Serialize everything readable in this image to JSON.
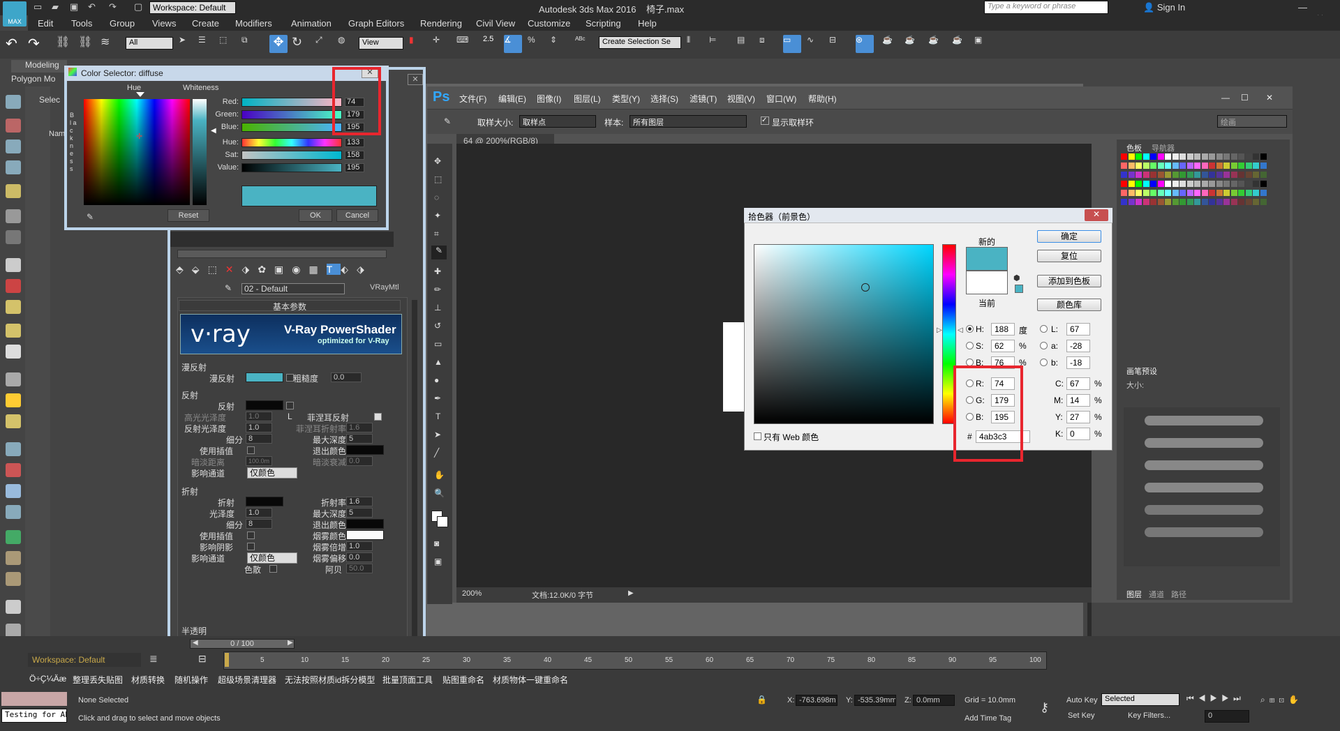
{
  "app": {
    "title": "Autodesk 3ds Max 2016",
    "file": "椅子.max",
    "logo": "MAX",
    "workspace": "Workspace: Default",
    "search_placeholder": "Type a keyword or phrase",
    "sign_in": "Sign In",
    "workspace_bottom": "Workspace: Default"
  },
  "menu": [
    "Edit",
    "Tools",
    "Group",
    "Views",
    "Create",
    "Modifiers",
    "Animation",
    "Graph Editors",
    "Rendering",
    "Civil View",
    "Customize",
    "Scripting",
    "Help"
  ],
  "toolbar": {
    "filter": "All",
    "view": "View",
    "snap": "2.5",
    "selset": "Create Selection Se"
  },
  "ribbon": {
    "tab1": "Modeling",
    "tab2": "Polygon Mo",
    "select": "Selec",
    "name": "Nam"
  },
  "colorsel": {
    "title": "Color Selector: diffuse",
    "hue": "Hue",
    "whiteness": "Whiteness",
    "blackness": "B l a c k n e s s",
    "red_label": "Red:",
    "green_label": "Green:",
    "blue_label": "Blue:",
    "hue_label": "Hue:",
    "sat_label": "Sat:",
    "value_label": "Value:",
    "red": "74",
    "green": "179",
    "blue": "195",
    "hue_val": "133",
    "sat_val": "158",
    "val_val": "195",
    "reset": "Reset",
    "ok": "OK",
    "cancel": "Cancel",
    "swatch": "#4ab3c3"
  },
  "mated": {
    "material": "02 - Default",
    "type": "VRayMtl",
    "basic": "基本参数",
    "vray_main": "V-Ray PowerShader",
    "vray_sub": "optimized for V-Ray",
    "vray_logo": "v·ray",
    "diffuse_group": "漫反射",
    "diffuse": "漫反射",
    "roughness": "粗糙度",
    "roughness_val": "0.0",
    "reflect_group": "反射",
    "reflect": "反射",
    "hilight": "高光光泽度",
    "hilight_val": "1.0",
    "refl_gloss": "反射光泽度",
    "refl_gloss_val": "1.0",
    "subdiv": "细分",
    "subdiv_val": "8",
    "use_interp": "使用插值",
    "dim_dist": "暗淡距离",
    "dim_dist_val": "100.0m",
    "affect_ch": "影响通道",
    "affect_val": "仅颜色",
    "fresnel": "菲涅耳反射",
    "fresnel_ior": "菲涅耳折射率",
    "fresnel_ior_val": "1.6",
    "max_depth": "最大深度",
    "max_depth_val": "5",
    "exit_color": "退出颜色",
    "dim_falloff": "暗淡衰减",
    "dim_falloff_val": "0.0",
    "L": "L",
    "refract_group": "折射",
    "refract": "折射",
    "gloss": "光泽度",
    "gloss_val": "1.0",
    "subdiv2": "细分",
    "subdiv2_val": "8",
    "use_interp2": "使用插值",
    "affect_shadow": "影响阴影",
    "affect_ch2": "影响通道",
    "affect_val2": "仅颜色",
    "dispersion": "色散",
    "ior": "折射率",
    "ior_val": "1.6",
    "max_depth2": "最大深度",
    "max_depth2_val": "5",
    "exit_color2": "退出颜色",
    "fog_color": "烟雾颜色",
    "fog_mult": "烟雾倍增",
    "fog_mult_val": "1.0",
    "fog_bias": "烟雾偏移",
    "fog_bias_val": "0.0",
    "abbe": "阿贝",
    "abbe_val": "50.0",
    "translucent": "半透明"
  },
  "ps": {
    "logo": "Ps",
    "menu": [
      "文件(F)",
      "编辑(E)",
      "图像(I)",
      "图层(L)",
      "类型(Y)",
      "选择(S)",
      "滤镜(T)",
      "视图(V)",
      "窗口(W)",
      "帮助(H)"
    ],
    "sample_size_label": "取样大小:",
    "sample_size": "取样点",
    "sample_label": "样本:",
    "sample": "所有图层",
    "show_ring": "显示取样环",
    "workspace": "绘画",
    "tab": "64 @ 200%(RGB/8)",
    "zoom": "200%",
    "doc": "文档:12.0K/0 字节",
    "panel_tab1": "色板",
    "panel_tab2": "导航器",
    "brush_title": "画笔预设",
    "size": "大小:",
    "layers": "图层",
    "channels": "通道",
    "paths": "路径"
  },
  "picker": {
    "title": "拾色器（前景色）",
    "new": "新的",
    "current": "当前",
    "ok": "确定",
    "reset": "复位",
    "add_swatch": "添加到色板",
    "color_lib": "颜色库",
    "H": "188",
    "H_unit": "度",
    "S": "62",
    "S_unit": "%",
    "B": "76",
    "B_unit": "%",
    "R": "74",
    "G": "179",
    "Bv": "195",
    "L": "67",
    "a": "-28",
    "b": "-18",
    "C": "67",
    "M": "14",
    "Y": "27",
    "K": "0",
    "hex": "4ab3c3",
    "web_only": "只有 Web 颜色",
    "color": "#4ab3c3",
    "lbl_H": "H:",
    "lbl_S": "S:",
    "lbl_B": "B:",
    "lbl_R": "R:",
    "lbl_G": "G:",
    "lbl_Bc": "B:",
    "lbl_L": "L:",
    "lbl_a": "a:",
    "lbl_b": "b:",
    "lbl_C": "C:",
    "lbl_M": "M:",
    "lbl_Y": "Y:",
    "lbl_K": "K:",
    "pct": "%",
    "hash": "#"
  },
  "timeline": {
    "frame": "0 / 100",
    "ticks": [
      "5",
      "10",
      "15",
      "20",
      "25",
      "30",
      "35",
      "40",
      "45",
      "50",
      "55",
      "60",
      "65",
      "70",
      "75",
      "80",
      "85",
      "90",
      "95",
      "100"
    ]
  },
  "plugins": [
    "Ö÷Ҫ¼Äæ",
    "整理丢失贴图",
    "材质转换",
    "随机操作",
    "超级场景清理器",
    "无法按照材质id拆分模型",
    "批量顶面工具",
    "贴图重命名",
    "材质物体一键重命名"
  ],
  "status": {
    "script": "Testing for AL",
    "none": "None Selected",
    "hint": "Click and drag to select and move objects",
    "x": "-763.698m",
    "y": "-535.39mm",
    "z": "0.0mm",
    "grid": "Grid = 10.0mm",
    "auto_key": "Auto Key",
    "selected": "Selected",
    "set_key": "Set Key",
    "key_filters": "Key Filters...",
    "frame": "0",
    "add_tag": "Add Time Tag",
    "xl": "X:",
    "yl": "Y:",
    "zl": "Z:"
  }
}
